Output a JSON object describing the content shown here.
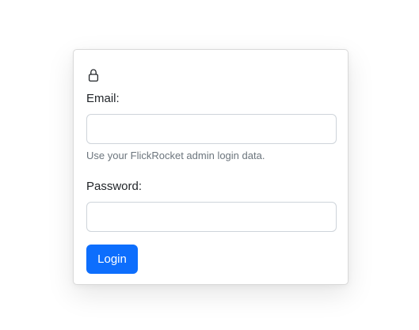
{
  "login_form": {
    "lock_icon": "lock-icon",
    "email_label": "Email:",
    "email_value": "",
    "email_placeholder": "",
    "email_help": "Use your FlickRocket admin login data.",
    "password_label": "Password:",
    "password_value": "",
    "password_placeholder": "",
    "login_label": "Login"
  },
  "colors": {
    "primary": "#0d6efd",
    "text": "#212529",
    "muted": "#6c757d",
    "border": "#ced4da"
  }
}
